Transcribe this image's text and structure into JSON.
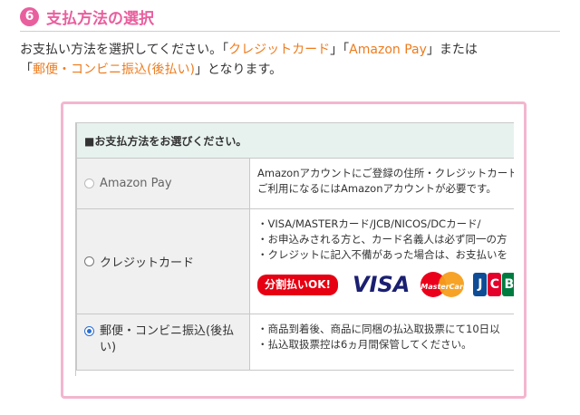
{
  "header": {
    "step_number": "6",
    "title": "支払方法の選択"
  },
  "intro": {
    "part1": "お支払い方法を選択してください。「",
    "credit": "クレジットカード",
    "part2": "」「",
    "amazon": "Amazon Pay",
    "part3": "」または",
    "part4": "「",
    "convenience": "郵便・コンビニ振込(後払い)",
    "part5": "」となります。"
  },
  "table": {
    "caption": "■お支払方法をお選びください。",
    "rows": [
      {
        "label": "Amazon Pay",
        "selected": false,
        "disabled": true,
        "lines": [
          "Amazonアカウントにご登録の住所・クレジットカード",
          "ご利用になるにはAmazonアカウントが必要です。"
        ]
      },
      {
        "label": "クレジットカード",
        "selected": false,
        "disabled": false,
        "lines": [
          "・VISA/MASTERカード/JCB/NICOS/DCカード/",
          "・お申込みされる方と、カード名義人は必ず同一の方",
          "・クレジットに記入不備があった場合は、お支払いを"
        ],
        "badge": "分割払いOK!",
        "brands": {
          "visa": "VISA",
          "mastercard": "MasterCard",
          "jcb": [
            "J",
            "C",
            "B"
          ]
        }
      },
      {
        "label_line1": "郵便・コンビニ振込(後払",
        "label_line2": "い)",
        "selected": true,
        "disabled": false,
        "lines": [
          "・商品到着後、商品に同梱の払込取扱票にて10日以",
          "・払込取扱票控は6ヵ月間保管してください。"
        ]
      }
    ]
  },
  "colors": {
    "accent_pink": "#e95f9e",
    "highlight_orange": "#ee7b1d",
    "frame_pink": "#f3b6cf",
    "caption_bg": "#e7f2ef"
  }
}
